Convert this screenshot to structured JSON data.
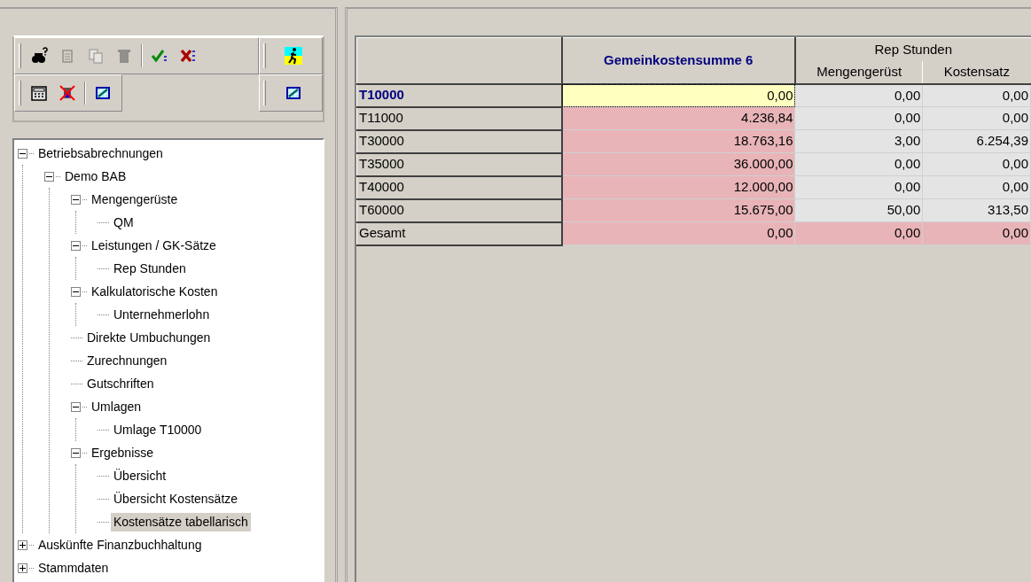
{
  "toolbar": {
    "rows": [
      {
        "groups": [
          [
            {
              "kind": "binoculars",
              "disabled": false
            },
            {
              "kind": "new",
              "disabled": true
            },
            {
              "kind": "copy",
              "disabled": true
            },
            {
              "kind": "trash",
              "disabled": true
            }
          ],
          [
            {
              "kind": "accept",
              "disabled": false
            },
            {
              "kind": "reject",
              "disabled": false
            }
          ]
        ],
        "end": {
          "kind": "runner",
          "disabled": false
        }
      },
      {
        "groups": [
          [
            {
              "kind": "calculator",
              "disabled": false
            },
            {
              "kind": "crossed",
              "disabled": false
            }
          ],
          [
            {
              "kind": "chart",
              "disabled": false
            }
          ]
        ],
        "end": {
          "kind": "chart",
          "disabled": false
        }
      }
    ]
  },
  "tree": [
    {
      "label": "Betriebsabrechnungen",
      "expanded": true,
      "selected": false,
      "children": [
        {
          "label": "Demo BAB",
          "expanded": true,
          "selected": false,
          "children": [
            {
              "label": "Mengengerüste",
              "expanded": true,
              "selected": false,
              "children": [
                {
                  "label": "QM",
                  "selected": false
                }
              ]
            },
            {
              "label": "Leistungen / GK-Sätze",
              "expanded": true,
              "selected": false,
              "children": [
                {
                  "label": "Rep Stunden",
                  "selected": false
                }
              ]
            },
            {
              "label": "Kalkulatorische Kosten",
              "expanded": true,
              "selected": false,
              "children": [
                {
                  "label": "Unternehmerlohn",
                  "selected": false
                }
              ]
            },
            {
              "label": "Direkte Umbuchungen",
              "selected": false
            },
            {
              "label": "Zurechnungen",
              "selected": false
            },
            {
              "label": "Gutschriften",
              "selected": false
            },
            {
              "label": "Umlagen",
              "expanded": true,
              "selected": false,
              "children": [
                {
                  "label": "Umlage T10000",
                  "selected": false
                }
              ]
            },
            {
              "label": "Ergebnisse",
              "expanded": true,
              "selected": false,
              "children": [
                {
                  "label": "Übersicht",
                  "selected": false
                },
                {
                  "label": "Übersicht Kostensätze",
                  "selected": false
                },
                {
                  "label": "Kostensätze tabellarisch",
                  "selected": true
                }
              ]
            }
          ]
        }
      ]
    },
    {
      "label": "Auskünfte Finanzbuchhaltung",
      "expanded": false,
      "selected": false
    },
    {
      "label": "Stammdaten",
      "expanded": false,
      "selected": false
    }
  ],
  "grid": {
    "column_group": "Rep Stunden",
    "columns": [
      {
        "label": "Gemeinkostensumme 6",
        "grouped": false
      },
      {
        "label": "Mengengerüst",
        "grouped": true
      },
      {
        "label": "Kostensatz",
        "grouped": true
      }
    ],
    "rows": [
      {
        "label": "T10000",
        "selected": true,
        "cells": [
          {
            "value": "0,00",
            "highlight": false,
            "selected": true
          },
          {
            "value": "0,00",
            "highlight": false,
            "selected": false
          },
          {
            "value": "0,00",
            "highlight": false,
            "selected": false
          }
        ]
      },
      {
        "label": "T11000",
        "selected": false,
        "cells": [
          {
            "value": "4.236,84",
            "highlight": true,
            "selected": false
          },
          {
            "value": "0,00",
            "highlight": false,
            "selected": false
          },
          {
            "value": "0,00",
            "highlight": false,
            "selected": false
          }
        ]
      },
      {
        "label": "T30000",
        "selected": false,
        "cells": [
          {
            "value": "18.763,16",
            "highlight": true,
            "selected": false
          },
          {
            "value": "3,00",
            "highlight": false,
            "selected": false
          },
          {
            "value": "6.254,39",
            "highlight": false,
            "selected": false
          }
        ]
      },
      {
        "label": "T35000",
        "selected": false,
        "cells": [
          {
            "value": "36.000,00",
            "highlight": true,
            "selected": false
          },
          {
            "value": "0,00",
            "highlight": false,
            "selected": false
          },
          {
            "value": "0,00",
            "highlight": false,
            "selected": false
          }
        ]
      },
      {
        "label": "T40000",
        "selected": false,
        "cells": [
          {
            "value": "12.000,00",
            "highlight": true,
            "selected": false
          },
          {
            "value": "0,00",
            "highlight": false,
            "selected": false
          },
          {
            "value": "0,00",
            "highlight": false,
            "selected": false
          }
        ]
      },
      {
        "label": "T60000",
        "selected": false,
        "cells": [
          {
            "value": "15.675,00",
            "highlight": true,
            "selected": false
          },
          {
            "value": "50,00",
            "highlight": false,
            "selected": false
          },
          {
            "value": "313,50",
            "highlight": false,
            "selected": false
          }
        ]
      },
      {
        "label": "Gesamt",
        "selected": false,
        "cells": [
          {
            "value": "0,00",
            "highlight": true,
            "selected": false
          },
          {
            "value": "0,00",
            "highlight": true,
            "selected": false
          },
          {
            "value": "0,00",
            "highlight": true,
            "selected": false
          }
        ]
      }
    ]
  }
}
